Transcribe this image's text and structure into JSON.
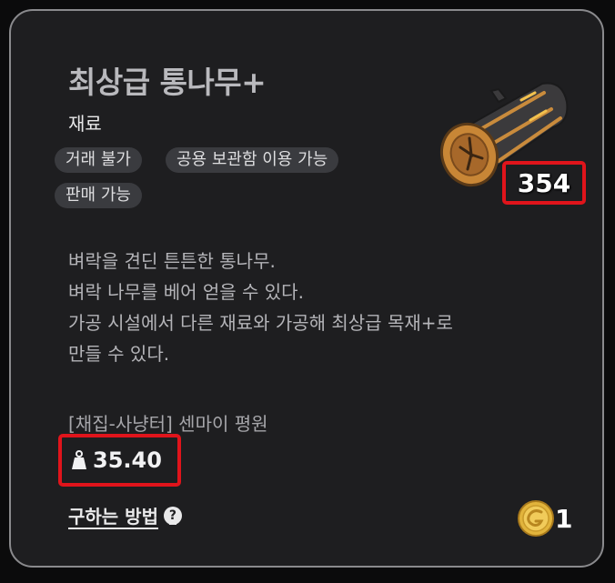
{
  "item": {
    "name": "최상급 통나무+",
    "category": "재료",
    "tags": [
      "거래 불가",
      "공용 보관함 이용 가능",
      "판매 가능"
    ],
    "count": "354",
    "description": [
      "벼락을 견딘 튼튼한 통나무.",
      "벼락 나무를 베어 얻을 수 있다.",
      "가공 시설에서 다른 재료와 가공해 최상급 목재+로",
      "만들 수 있다."
    ],
    "source": "[채집-사냥터] 센마이 평원",
    "weight": "35.40",
    "how_to_obtain": "구하는 방법",
    "price": "1"
  },
  "icons": {
    "item": "log-icon",
    "weight": "weight-icon",
    "help": "help-icon",
    "currency": "gold-coin-icon"
  },
  "colors": {
    "highlight_border": "#e0141b",
    "card_bg": "#1e1e20",
    "tag_bg": "#3a3b3f"
  }
}
